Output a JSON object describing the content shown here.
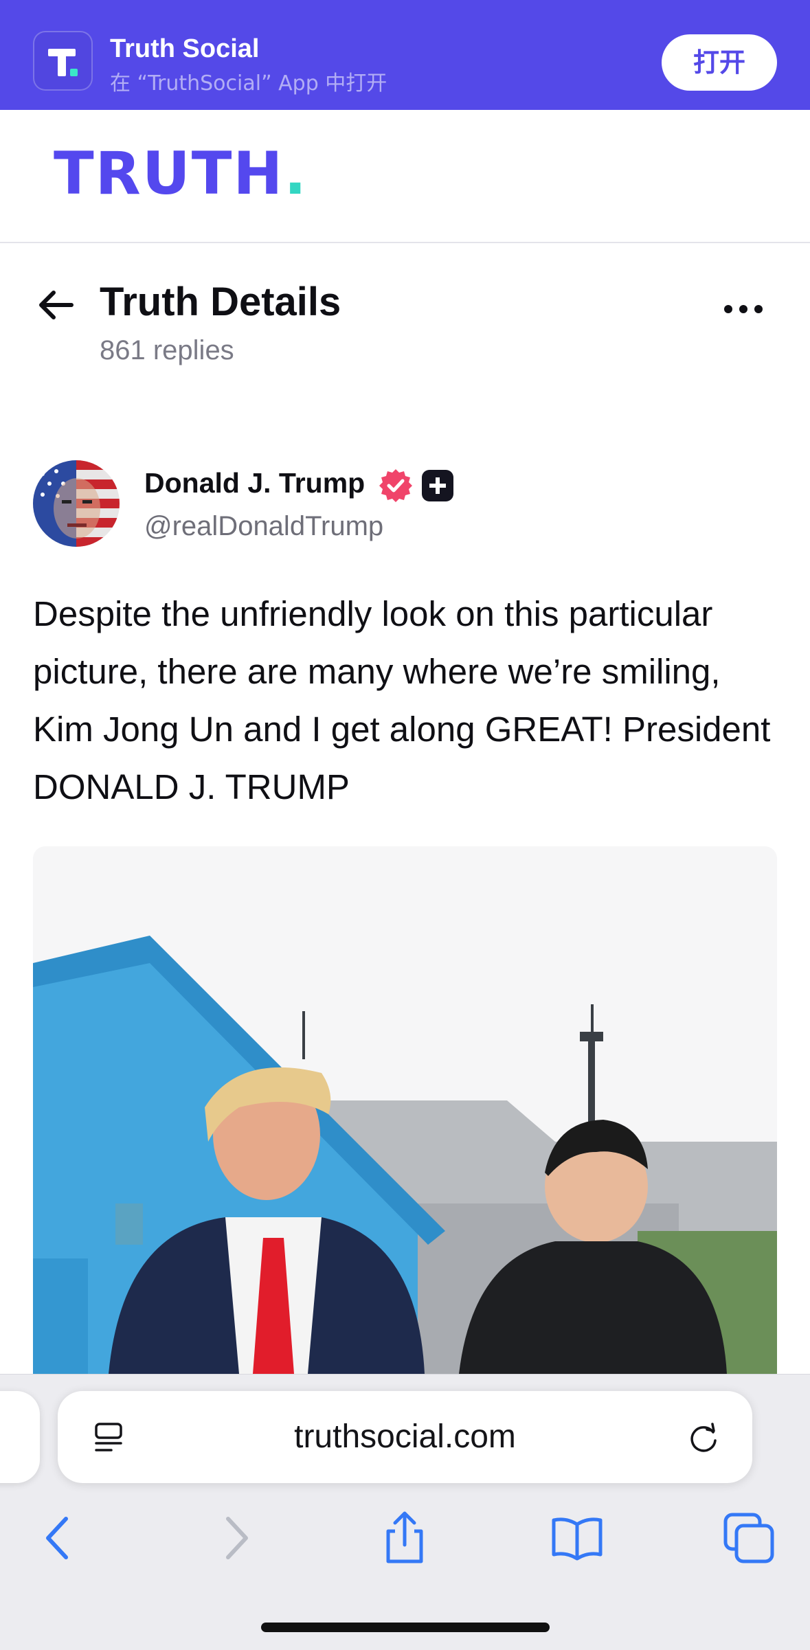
{
  "banner": {
    "app_name": "Truth Social",
    "subtitle": "在 “TruthSocial” App 中打开",
    "open_label": "打开",
    "brand_color": "#5449e8"
  },
  "site": {
    "logo_text": "TRUTH",
    "logo_dot": ".",
    "logo_color": "#5448ee",
    "dot_color": "#33d6c2"
  },
  "details": {
    "title": "Truth Details",
    "replies": "861 replies",
    "back_icon": "arrow-left-icon",
    "more_icon": "more-horizontal-icon"
  },
  "post": {
    "author_name": "Donald J. Trump",
    "handle": "@realDonaldTrump",
    "text": "Despite the unfriendly look on this particular picture, there are many where we’re smiling, Kim Jong Un and I get along GREAT! President DONALD J. TRUMP",
    "verified_icon": "verified-badge-icon",
    "plus_icon": "truth-plus-badge-icon",
    "verified_color": "#f0446a"
  },
  "browser": {
    "url": "truthsocial.com",
    "reader_icon": "reader-mode-icon",
    "reload_icon": "reload-icon",
    "toolbar_icons": [
      "back-icon",
      "forward-icon",
      "share-icon",
      "bookmarks-icon",
      "tabs-icon"
    ],
    "accent_color": "#3478f6"
  }
}
